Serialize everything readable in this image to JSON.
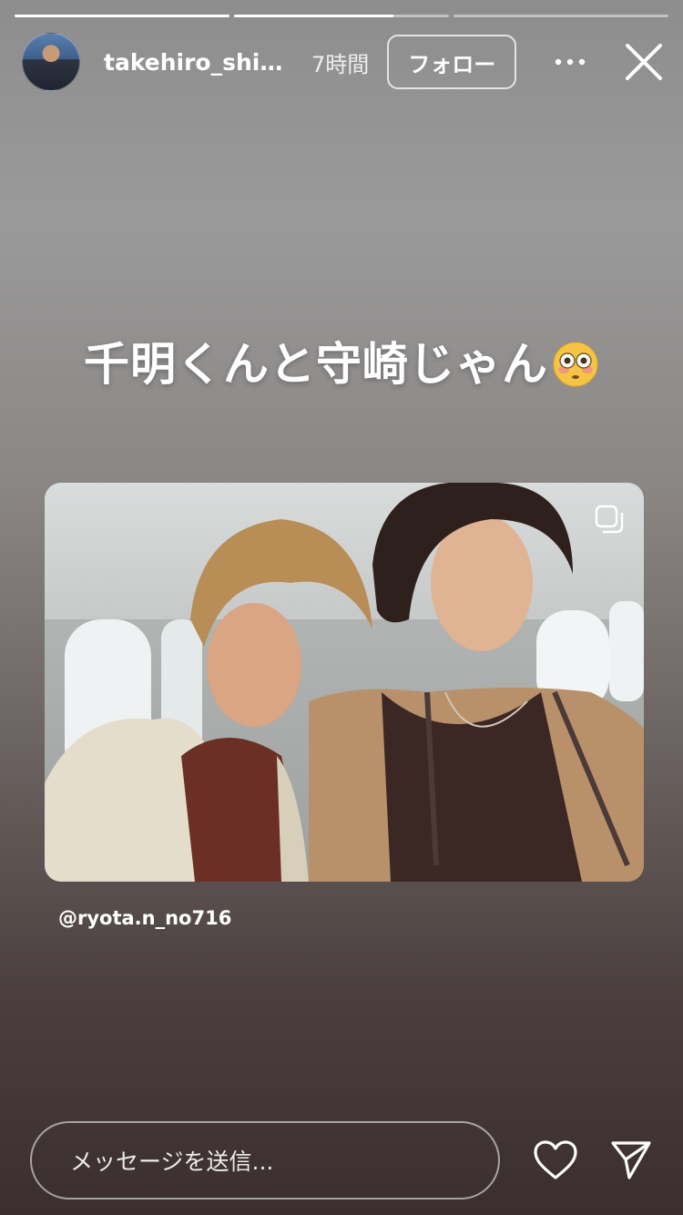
{
  "story": {
    "progress": [
      1.0,
      0.74,
      0.0
    ]
  },
  "header": {
    "username": "takehiro_shin...",
    "time": "7時間",
    "follow_label": "フォロー",
    "more_icon": "more-horizontal-icon",
    "close_icon": "close-icon"
  },
  "caption": {
    "text": "千明くんと守崎じゃん",
    "emoji": "flushed-face"
  },
  "post": {
    "mention": "@ryota.n_no716",
    "multi_icon": "carousel-icon"
  },
  "footer": {
    "message_placeholder": "メッセージを送信...",
    "like_icon": "heart-icon",
    "send_icon": "send-icon"
  }
}
